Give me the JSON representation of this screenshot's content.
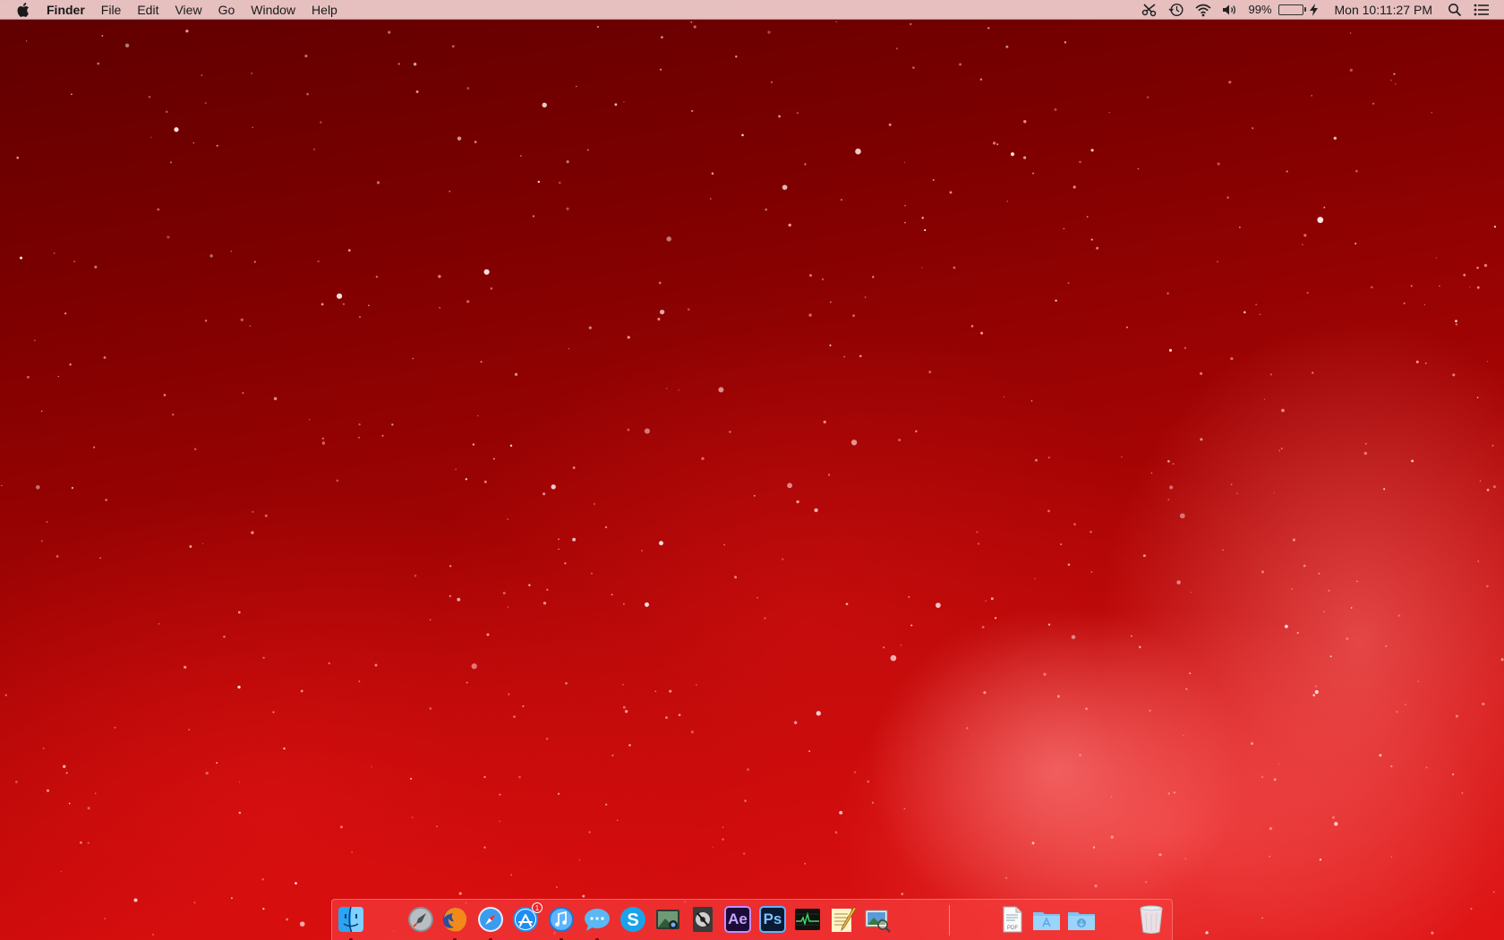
{
  "menubar": {
    "app_name": "Finder",
    "menus": [
      "File",
      "Edit",
      "View",
      "Go",
      "Window",
      "Help"
    ],
    "status": {
      "battery_percent_label": "99%",
      "battery_level": 0.99,
      "clock": "Mon 10:11:27 PM"
    },
    "icons": [
      "apple-icon",
      "bluetooth-scissors-icon",
      "time-machine-icon",
      "wifi-icon",
      "volume-icon",
      "battery-icon",
      "charging-bolt-icon",
      "spotlight-search-icon",
      "notification-center-icon"
    ]
  },
  "dock": {
    "apps": [
      {
        "name": "finder-icon",
        "running": true
      },
      {
        "name": "launchpad-icon",
        "running": false
      },
      {
        "name": "firefox-icon",
        "running": true
      },
      {
        "name": "safari-icon",
        "running": true
      },
      {
        "name": "app-store-icon",
        "running": false,
        "badge": "1"
      },
      {
        "name": "itunes-icon",
        "running": true
      },
      {
        "name": "messages-icon",
        "running": true
      },
      {
        "name": "skype-icon",
        "running": false
      },
      {
        "name": "photo-booth-icon",
        "running": false
      },
      {
        "name": "final-cut-icon",
        "running": false
      },
      {
        "name": "after-effects-icon",
        "running": false,
        "label": "Ae"
      },
      {
        "name": "photoshop-icon",
        "running": false,
        "label": "Ps"
      },
      {
        "name": "activity-monitor-icon",
        "running": false
      },
      {
        "name": "textedit-icon",
        "running": false
      },
      {
        "name": "preview-icon",
        "running": false
      }
    ],
    "docs": [
      {
        "name": "pdf-document-icon",
        "label": "PDF"
      },
      {
        "name": "applications-folder-icon"
      },
      {
        "name": "downloads-folder-icon"
      },
      {
        "name": "trash-icon"
      }
    ]
  },
  "colors": {
    "menubar_bg": "#f0cdcd",
    "dock_bg": "#f53c3c",
    "wallpaper_dark": "#5e0000",
    "wallpaper_light": "#e01414"
  }
}
